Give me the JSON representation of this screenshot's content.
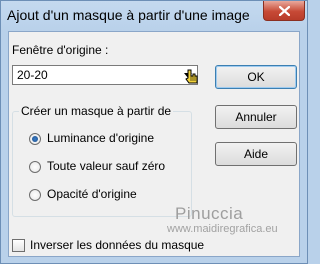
{
  "window": {
    "title": "Ajout d'un masque à partir d'une image",
    "close_icon": "close-x-icon"
  },
  "source": {
    "label": "Fenêtre d'origine :",
    "selected_value": "20-20",
    "dropdown_icon": "chevron-down-icon",
    "cursor_icon": "hand-pointer-icon"
  },
  "buttons": {
    "ok": "OK",
    "cancel": "Annuler",
    "help": "Aide"
  },
  "mask_group": {
    "legend": "Créer un masque à partir de",
    "options": [
      {
        "label": "Luminance d'origine",
        "checked": true
      },
      {
        "label": "Toute valeur sauf zéro",
        "checked": false
      },
      {
        "label": "Opacité d'origine",
        "checked": false
      }
    ]
  },
  "invert": {
    "label": "Inverser les données du masque",
    "checked": false
  },
  "watermark": {
    "name": "Pinuccia",
    "url": "www.maidiregrafica.eu"
  },
  "colors": {
    "frame": "#b9d1ea",
    "client": "#f0f0f0",
    "close_button": "#c74a36",
    "default_button_border": "#3c7fb1"
  }
}
